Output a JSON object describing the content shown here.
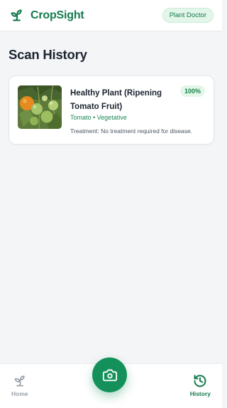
{
  "app": {
    "name": "CropSight",
    "mode_badge": "Plant Doctor",
    "brand_color": "#137a4d",
    "logo_icon": "sprout-icon"
  },
  "page": {
    "title": "Scan History"
  },
  "scans": [
    {
      "title": "Healthy Plant (Ripening Tomato Fruit)",
      "confidence": "100%",
      "meta": "Tomato • Vegetative",
      "treatment": "Treatment: No treatment required for disease.",
      "thumbnail": "tomato-plant-photo"
    }
  ],
  "bottom_nav": {
    "home_label": "Home",
    "home_icon": "sprout-icon",
    "camera_icon": "camera-icon",
    "history_label": "History",
    "history_icon": "history-icon",
    "active": "History"
  }
}
